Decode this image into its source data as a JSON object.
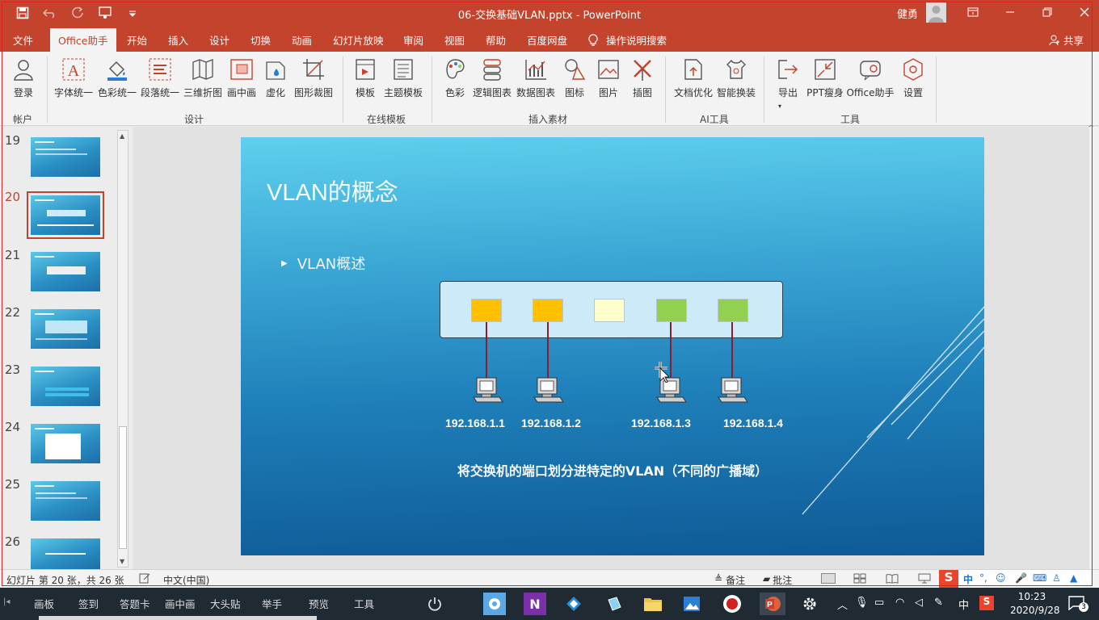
{
  "window": {
    "title": "06-交换基础VLAN.pptx  -  PowerPoint",
    "user_name": "健勇",
    "colors": {
      "accent": "#c4432d",
      "slide_top": "#5fd0ee",
      "slide_bottom": "#0e5a96"
    }
  },
  "quick_access": [
    "save-icon",
    "undo-icon",
    "redo-icon",
    "touch-mode-icon",
    "customize-icon"
  ],
  "tabs": [
    {
      "label": "文件"
    },
    {
      "label": "Office助手"
    },
    {
      "label": "开始"
    },
    {
      "label": "插入"
    },
    {
      "label": "设计"
    },
    {
      "label": "切换"
    },
    {
      "label": "动画"
    },
    {
      "label": "幻灯片放映"
    },
    {
      "label": "审阅"
    },
    {
      "label": "视图"
    },
    {
      "label": "帮助"
    },
    {
      "label": "百度网盘"
    },
    {
      "label": "操作说明搜索"
    }
  ],
  "share_label": "共享",
  "ribbon": {
    "buttons": [
      {
        "label": "登录"
      },
      {
        "label": "字体统一"
      },
      {
        "label": "色彩统一"
      },
      {
        "label": "段落统一"
      },
      {
        "label": "三维折图"
      },
      {
        "label": "画中画"
      },
      {
        "label": "虚化"
      },
      {
        "label": "图形裁图"
      },
      {
        "label": "模板"
      },
      {
        "label": "主题模板"
      },
      {
        "label": "色彩"
      },
      {
        "label": "逻辑图表"
      },
      {
        "label": "数据图表"
      },
      {
        "label": "图标"
      },
      {
        "label": "图片"
      },
      {
        "label": "插图"
      },
      {
        "label": "文档优化"
      },
      {
        "label": "智能换装"
      },
      {
        "label": "导出"
      },
      {
        "label": "PPT瘦身"
      },
      {
        "label": "Office助手"
      },
      {
        "label": "设置"
      }
    ],
    "groups": [
      {
        "label": "帐户"
      },
      {
        "label": "设计"
      },
      {
        "label": "在线模板"
      },
      {
        "label": "插入素材"
      },
      {
        "label": "AI工具"
      },
      {
        "label": "工具"
      }
    ]
  },
  "thumbnails": [
    {
      "number": "19",
      "selected": false
    },
    {
      "number": "20",
      "selected": true
    },
    {
      "number": "21",
      "selected": false
    },
    {
      "number": "22",
      "selected": false
    },
    {
      "number": "23",
      "selected": false
    },
    {
      "number": "24",
      "selected": false
    },
    {
      "number": "25",
      "selected": false
    },
    {
      "number": "26",
      "selected": false
    }
  ],
  "slide": {
    "title": "VLAN的概念",
    "bullet": "VLAN概述",
    "ports": [
      {
        "color": "#ffc000"
      },
      {
        "color": "#ffc000"
      },
      {
        "color": "#ffffcc"
      },
      {
        "color": "#92d050"
      },
      {
        "color": "#92d050"
      }
    ],
    "ips": [
      "192.168.1.1",
      "192.168.1.2",
      "192.168.1.3",
      "192.168.1.4"
    ],
    "caption": "将交换机的端口划分进特定的VLAN（不同的广播域）"
  },
  "status": {
    "slide_info": "幻灯片 第 20 张，共 26 张",
    "language": "中文(中国)",
    "notes": "备注",
    "comments": "批注"
  },
  "taskbar": {
    "items": [
      "画板",
      "签到",
      "答题卡",
      "画中画",
      "大头贴",
      "举手",
      "预览",
      "工具"
    ],
    "ime": "中",
    "time": "10:23",
    "date": "2020/9/28",
    "notifications": "3"
  }
}
